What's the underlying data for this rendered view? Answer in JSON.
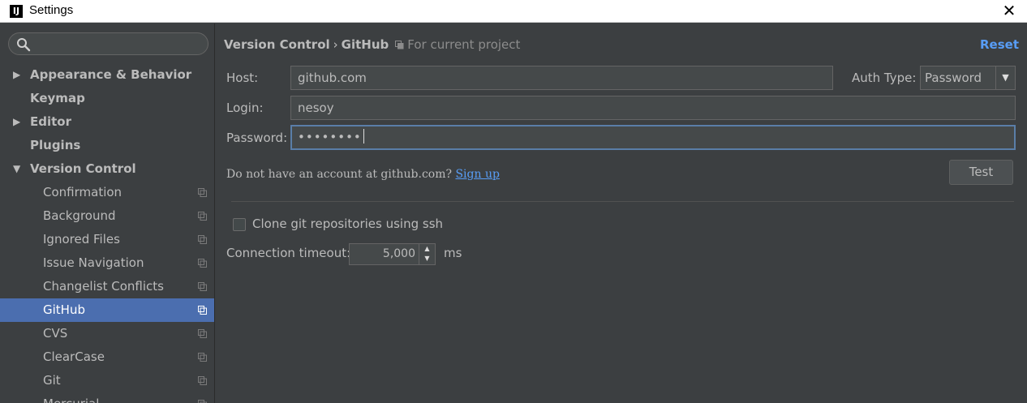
{
  "window": {
    "title": "Settings",
    "app_icon": "IJ",
    "close_glyph": "✕"
  },
  "sidebar": {
    "search": {
      "value": "",
      "placeholder": ""
    },
    "items": [
      {
        "label": "Appearance & Behavior",
        "level": 0,
        "arrow": "▶",
        "scoped": false
      },
      {
        "label": "Keymap",
        "level": 0,
        "arrow": "",
        "scoped": false
      },
      {
        "label": "Editor",
        "level": 0,
        "arrow": "▶",
        "scoped": false
      },
      {
        "label": "Plugins",
        "level": 0,
        "arrow": "",
        "scoped": false
      },
      {
        "label": "Version Control",
        "level": 0,
        "arrow": "▼",
        "scoped": false
      },
      {
        "label": "Confirmation",
        "level": 1,
        "scoped": true
      },
      {
        "label": "Background",
        "level": 1,
        "scoped": true
      },
      {
        "label": "Ignored Files",
        "level": 1,
        "scoped": true
      },
      {
        "label": "Issue Navigation",
        "level": 1,
        "scoped": true
      },
      {
        "label": "Changelist Conflicts",
        "level": 1,
        "scoped": true
      },
      {
        "label": "GitHub",
        "level": 1,
        "scoped": true,
        "selected": true
      },
      {
        "label": "CVS",
        "level": 1,
        "scoped": true
      },
      {
        "label": "ClearCase",
        "level": 1,
        "scoped": true
      },
      {
        "label": "Git",
        "level": 1,
        "scoped": true
      },
      {
        "label": "Mercurial",
        "level": 1,
        "scoped": true
      }
    ]
  },
  "header": {
    "breadcrumb_parent": "Version Control",
    "breadcrumb_sep": "›",
    "breadcrumb_current": "GitHub",
    "scope_text": "For current project",
    "reset_label": "Reset"
  },
  "form": {
    "host_label": "Host:",
    "host_value": "github.com",
    "auth_type_label": "Auth Type:",
    "auth_type_value": "Password",
    "login_label": "Login:",
    "login_value": "nesoy",
    "password_label": "Password:",
    "password_value": "••••••••",
    "signup_text": "Do not have an account at github.com?",
    "signup_link": "Sign up",
    "test_label": "Test",
    "clone_ssh_label": "Clone git repositories using ssh",
    "clone_ssh_checked": false,
    "timeout_label": "Connection timeout:",
    "timeout_value": "5,000",
    "timeout_unit": "ms"
  },
  "colors": {
    "background": "#3c3f41",
    "selection": "#4b6eaf",
    "link": "#589df6",
    "text": "#bbbbbb"
  }
}
